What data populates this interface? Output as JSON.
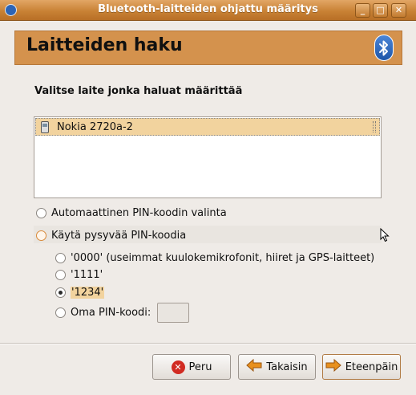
{
  "window": {
    "title": "Bluetooth-laitteiden ohjattu määritys",
    "minimize_glyph": "_",
    "maximize_glyph": "□",
    "close_glyph": "✕"
  },
  "header": {
    "title": "Laitteiden haku",
    "logo_icon": "bluetooth-icon"
  },
  "device_section": {
    "label": "Valitse laite jonka haluat määrittää",
    "devices": [
      {
        "name": "Nokia 2720a-2",
        "icon": "phone-icon",
        "selected": true
      }
    ]
  },
  "pin_options": {
    "auto_label": "Automaattinen PIN-koodin valinta",
    "fixed_label": "Käytä pysyvää PIN-koodia",
    "fixed_choices": [
      {
        "label": "'0000' (useimmat kuulokemikrofonit, hiiret ja GPS-laitteet)",
        "checked": false
      },
      {
        "label": "'1111'",
        "checked": false
      },
      {
        "label": "'1234'",
        "checked": true
      },
      {
        "label": "Oma PIN-koodi:",
        "checked": false
      }
    ],
    "custom_pin_value": ""
  },
  "buttons": {
    "cancel": "Peru",
    "back": "Takaisin",
    "next": "Eteenpäin"
  },
  "colors": {
    "titlebar": "#c98235",
    "header_bg": "#d4924d",
    "selection": "#f2d39e",
    "cancel_icon": "#d12b22",
    "arrow_icon": "#e8901e"
  }
}
